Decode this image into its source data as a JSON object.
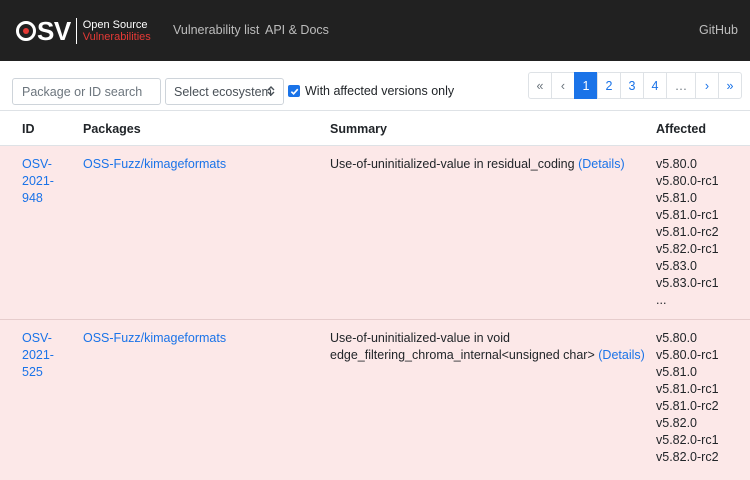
{
  "header": {
    "logo": {
      "mark": "SV",
      "line1": "Open Source",
      "line2": "Vulnerabilities"
    },
    "nav": [
      "Vulnerability list",
      "API & Docs"
    ],
    "github": "GitHub"
  },
  "filters": {
    "search_placeholder": "Package or ID search",
    "ecosystem_label": "Select ecosystem",
    "affected_checkbox_label": "With affected versions only",
    "affected_checked": true
  },
  "pagination": {
    "first": "«",
    "prev": "‹",
    "pages": [
      "1",
      "2",
      "3",
      "4"
    ],
    "ellipsis": "…",
    "next": "›",
    "last": "»",
    "current": "1"
  },
  "table": {
    "columns": [
      "ID",
      "Packages",
      "Summary",
      "Affected"
    ],
    "rows": [
      {
        "id_lines": [
          "OSV-",
          "2021-",
          "948"
        ],
        "package": "OSS-Fuzz/kimageformats",
        "summary_lines": [
          "Use-of-uninitialized-value in residual_coding"
        ],
        "details": "(Details)",
        "affected": [
          "v5.80.0",
          "v5.80.0-rc1",
          "v5.81.0",
          "v5.81.0-rc1",
          "v5.81.0-rc2",
          "v5.82.0-rc1",
          "v5.83.0",
          "v5.83.0-rc1",
          "..."
        ]
      },
      {
        "id_lines": [
          "OSV-",
          "2021-",
          "525"
        ],
        "package": "OSS-Fuzz/kimageformats",
        "summary_lines": [
          "Use-of-uninitialized-value in void",
          "edge_filtering_chroma_internal<unsigned char>"
        ],
        "details": "(Details)",
        "affected": [
          "v5.80.0",
          "v5.80.0-rc1",
          "v5.81.0",
          "v5.81.0-rc1",
          "v5.81.0-rc2",
          "v5.82.0",
          "v5.82.0-rc1",
          "v5.82.0-rc2"
        ]
      }
    ]
  },
  "colors": {
    "accent": "#1a73e8",
    "header_bg": "#212121",
    "logo_red": "#e53935",
    "row_bg": "#fce8e8"
  }
}
